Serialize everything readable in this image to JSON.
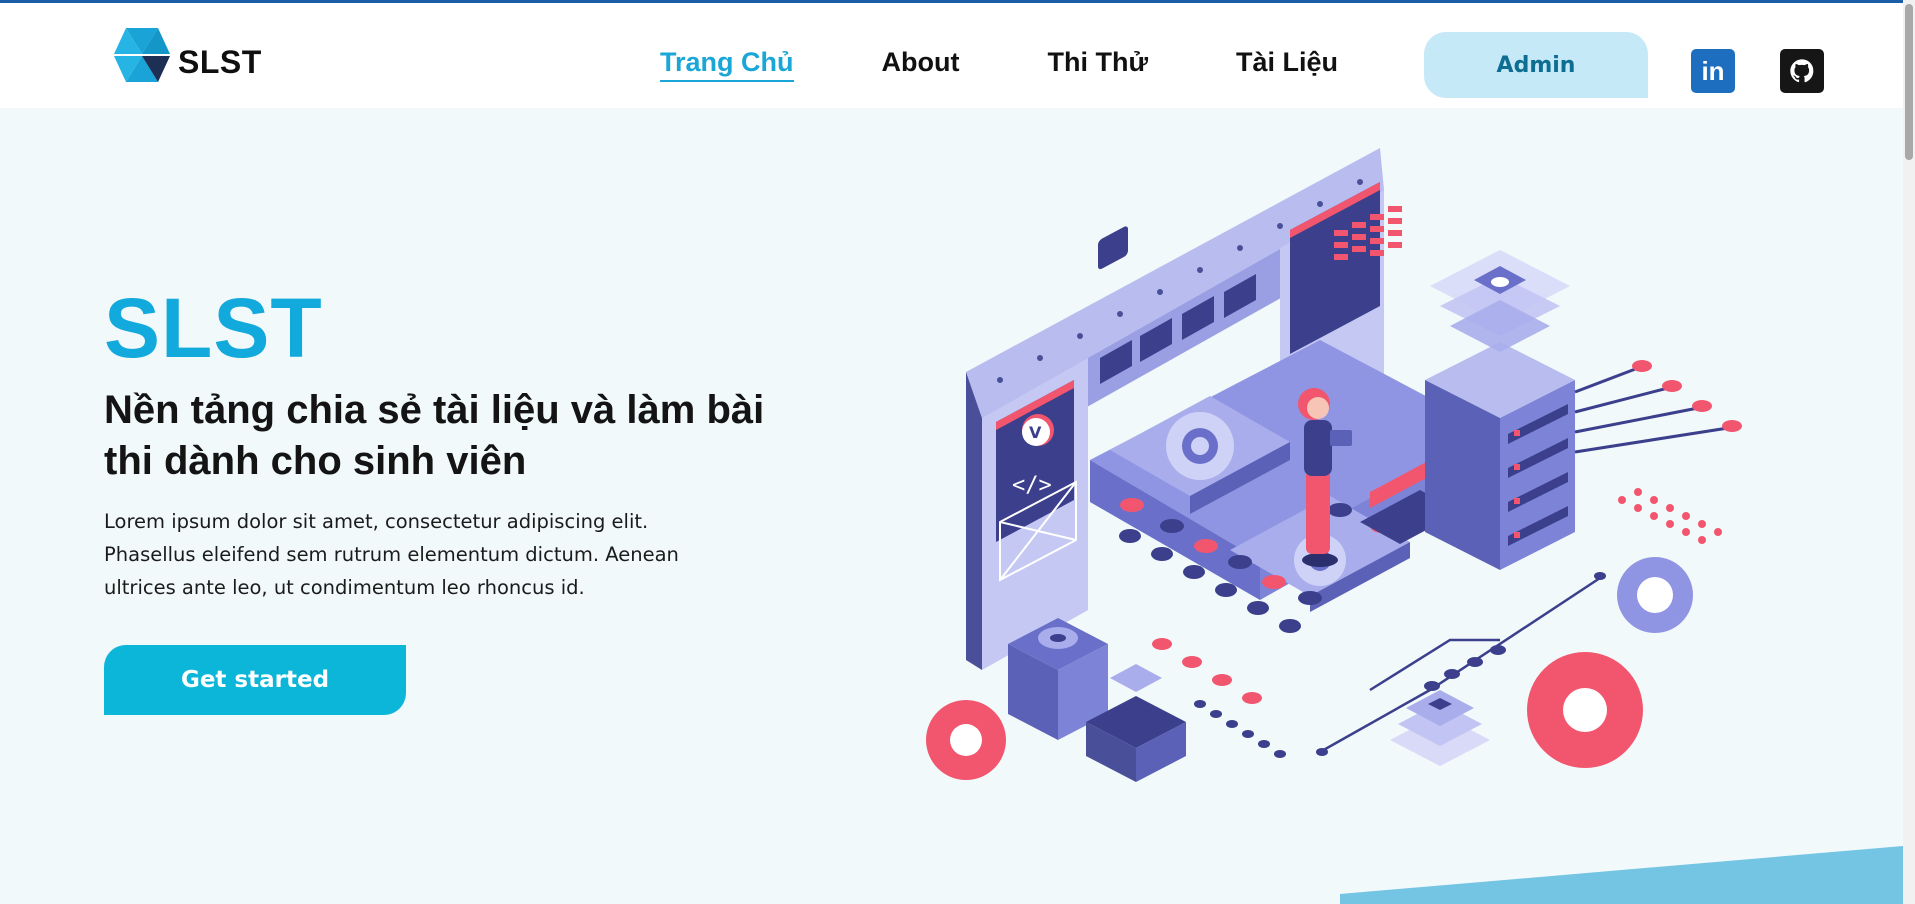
{
  "header": {
    "logo_text": "SLST",
    "nav": [
      {
        "label": "Trang Chủ",
        "active": true
      },
      {
        "label": "About",
        "active": false
      },
      {
        "label": "Thi Thử",
        "active": false
      },
      {
        "label": "Tài Liệu",
        "active": false
      }
    ],
    "admin_label": "Admin",
    "linkedin_icon": "linkedin-icon",
    "linkedin_glyph": "in",
    "github_icon": "github-icon"
  },
  "hero": {
    "title": "SLST",
    "subtitle": "Nền tảng chia sẻ tài liệu và làm bài thi dành cho sinh viên",
    "description": "Lorem ipsum dolor sit amet, consectetur adipiscing elit. Phasellus eleifend sem rutrum elementum dictum. Aenean ultrices ante leo, ut condimentum leo rhoncus id.",
    "cta_label": "Get started",
    "illustration": "isometric-factory-illustration"
  },
  "colors": {
    "accent": "#12a9dc",
    "button": "#0bb6d9",
    "admin_bg": "#c5e9f6",
    "background": "#f1f9fb",
    "illustration_purple": "#7d83d6",
    "illustration_red": "#f2566e"
  }
}
